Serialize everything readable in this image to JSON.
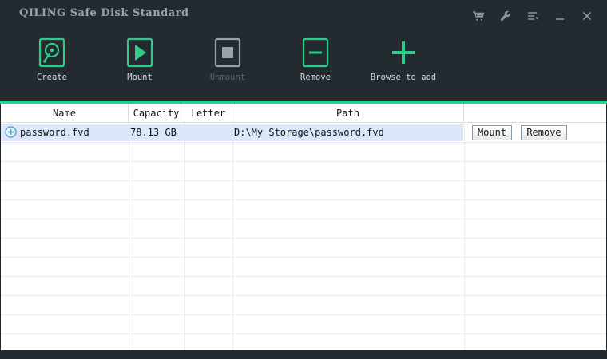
{
  "window": {
    "title": "QILING Safe Disk Standard",
    "controls": [
      {
        "name": "cart-icon"
      },
      {
        "name": "wrench-icon"
      },
      {
        "name": "menu-icon"
      },
      {
        "name": "minimize-icon"
      },
      {
        "name": "close-icon"
      }
    ]
  },
  "toolbar": {
    "create_label": "Create",
    "mount_label": "Mount",
    "unmount_label": "Unmount",
    "remove_label": "Remove",
    "browse_label": "Browse to add"
  },
  "table": {
    "columns": [
      "Name",
      "Capacity",
      "Letter",
      "Path",
      ""
    ],
    "rows": [
      {
        "name": "password.fvd",
        "capacity": "78.13 GB",
        "letter": "",
        "path": "D:\\My Storage\\password.fvd",
        "mount_label": "Mount",
        "remove_label": "Remove"
      }
    ]
  },
  "colors": {
    "accent": "#2ecc8a",
    "titlebar": "#232a30",
    "selected_row": "#dce8fa"
  }
}
